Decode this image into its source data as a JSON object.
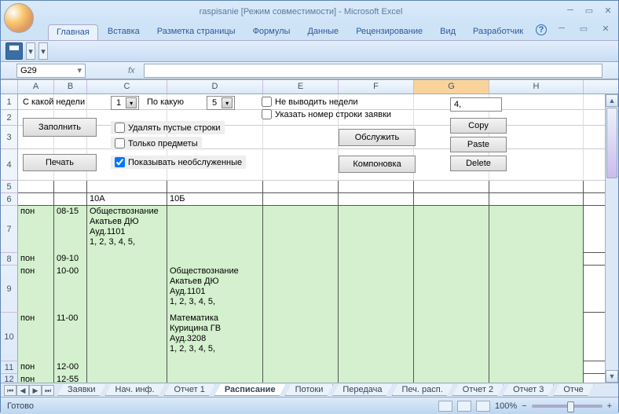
{
  "title": "raspisanie  [Режим совместимости] - Microsoft Excel",
  "ribbon_tabs": [
    "Главная",
    "Вставка",
    "Разметка страницы",
    "Формулы",
    "Данные",
    "Рецензирование",
    "Вид",
    "Разработчик"
  ],
  "namebox": "G29",
  "controls": {
    "label_from_week": "С какой недели",
    "from_week_value": "1",
    "label_to_week": "По какую",
    "to_week_value": "5",
    "btn_fill": "Заполнить",
    "btn_print": "Печать",
    "chk_delete_empty": "Удалять пустые строки",
    "chk_only_subjects": "Только предметы",
    "chk_show_unserved": "Показывать необслуженные",
    "chk_show_unserved_checked": true,
    "chk_no_weeks": "Не выводить недели",
    "chk_row_number": "Указать номер строки заявки",
    "btn_serve": "Обслужить",
    "btn_layout": "Компоновка",
    "txt_value": "4,",
    "btn_copy": "Copy",
    "btn_paste": "Paste",
    "btn_delete": "Delete"
  },
  "columns": [
    {
      "letter": "A",
      "w": 46
    },
    {
      "letter": "B",
      "w": 42
    },
    {
      "letter": "C",
      "w": 102
    },
    {
      "letter": "D",
      "w": 122
    },
    {
      "letter": "E",
      "w": 96
    },
    {
      "letter": "F",
      "w": 96
    },
    {
      "letter": "G",
      "w": 96
    },
    {
      "letter": "H",
      "w": 120
    }
  ],
  "rows": [
    {
      "n": "1",
      "h": 20
    },
    {
      "n": "2",
      "h": 20
    },
    {
      "n": "3",
      "h": 30
    },
    {
      "n": "4",
      "h": 40
    },
    {
      "n": "5",
      "h": 16
    },
    {
      "n": "6",
      "h": 16
    },
    {
      "n": "7",
      "h": 60
    },
    {
      "n": "8",
      "h": 16
    },
    {
      "n": "9",
      "h": 60
    },
    {
      "n": "10",
      "h": 62
    },
    {
      "n": "11",
      "h": 16
    },
    {
      "n": "12",
      "h": 14
    }
  ],
  "data": {
    "r6": {
      "C": "10А",
      "D": "10Б"
    },
    "r7": {
      "A": "пон",
      "B": "08-15",
      "C": "Обществознание\nАкатьев ДЮ\nАуд.1101\n  1, 2, 3, 4, 5,"
    },
    "r8": {
      "A": "пон",
      "B": "09-10"
    },
    "r9": {
      "A": "пон",
      "B": "10-00",
      "D": "Обществознание\nАкатьев ДЮ\nАуд.1101\n  1, 2, 3, 4, 5,"
    },
    "r10": {
      "A": "пон",
      "B": "11-00",
      "D": "Математика\nКурицина ГВ\nАуд.3208\n  1, 2, 3, 4, 5,"
    },
    "r11": {
      "A": "пон",
      "B": "12-00"
    },
    "r12": {
      "A": "пон",
      "B": "12-55"
    }
  },
  "sheet_tabs": [
    "Заявки",
    "Нач. инф.",
    "Отчет 1",
    "Расписание",
    "Потоки",
    "Передача",
    "Печ. расп.",
    "Отчет 2",
    "Отчет 3",
    "Отче"
  ],
  "active_sheet": 3,
  "status": "Готово",
  "zoom": "100%"
}
